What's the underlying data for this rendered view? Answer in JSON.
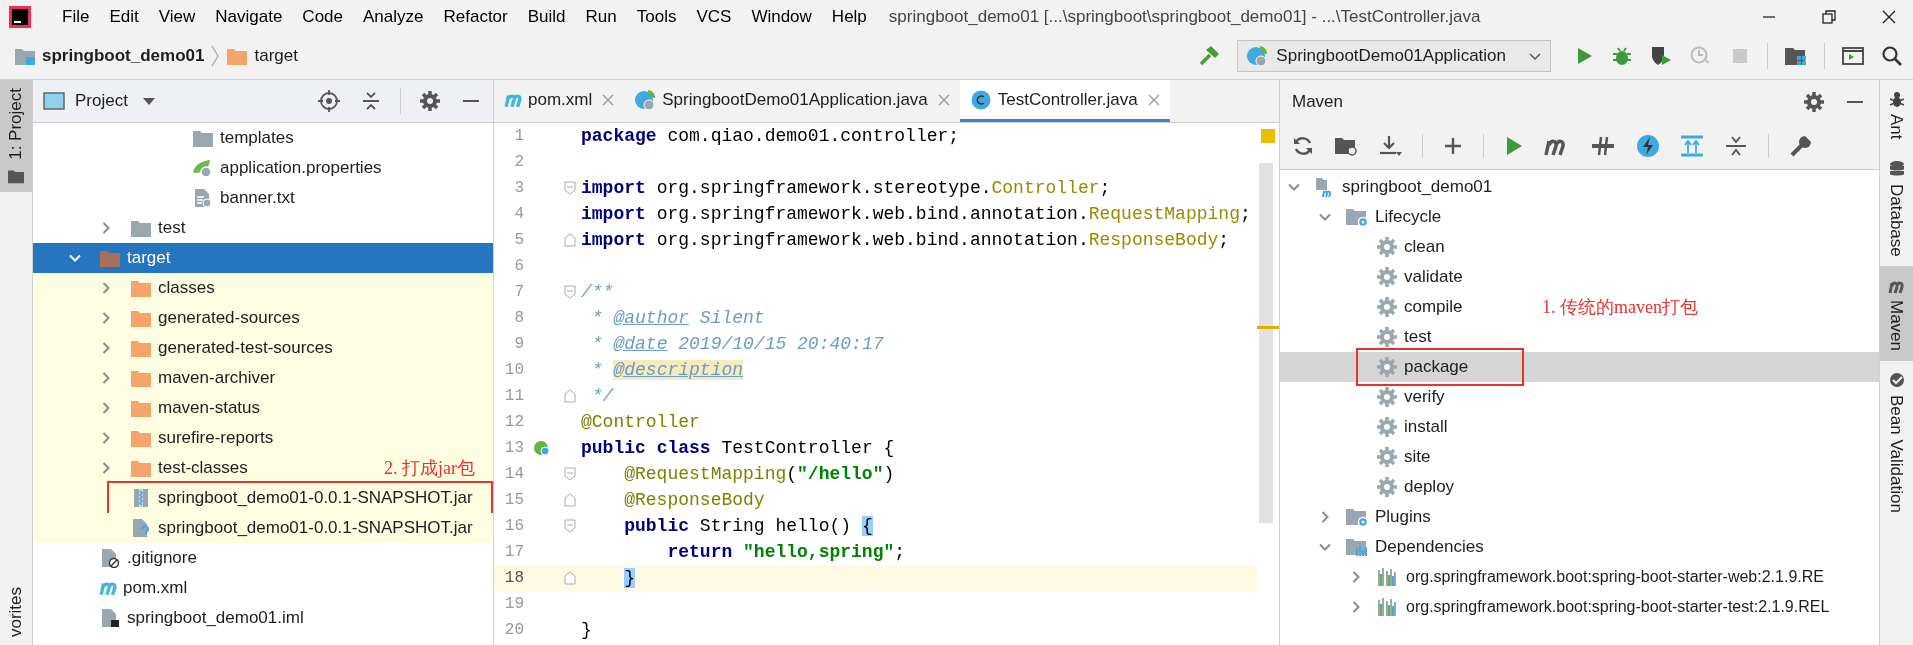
{
  "menu_bar": {
    "items": [
      "File",
      "Edit",
      "View",
      "Navigate",
      "Code",
      "Analyze",
      "Refactor",
      "Build",
      "Run",
      "Tools",
      "VCS",
      "Window",
      "Help"
    ],
    "title": "springboot_demo01 [...\\springboot\\springboot_demo01] - ...\\TestController.java"
  },
  "navigation_bar": {
    "breadcrumbs": [
      {
        "label": "springboot_demo01",
        "kind": "module"
      },
      {
        "label": "target",
        "kind": "output-folder"
      }
    ],
    "run_configuration": "SpringbootDemo01Application"
  },
  "left_strip": [
    {
      "label": "1: Project",
      "selected": true
    },
    {
      "label": "vorites",
      "selected": false
    }
  ],
  "project_panel": {
    "title": "Project",
    "tree": [
      {
        "children": [
          {
            "children": [
              {
                "children": [
                  {
                    "kind": "folder",
                    "label": "templates",
                    "selected": false,
                    "boxed": false
                  },
                  {
                    "kind": "properties-file",
                    "label": "application.properties",
                    "selected": false,
                    "boxed": false
                  },
                  {
                    "kind": "text-file",
                    "label": "banner.txt",
                    "selected": false,
                    "boxed": false
                  }
                ]
              }
            ]
          },
          {
            "kind": "folder",
            "label": "test",
            "expanded": false,
            "selected": false,
            "boxed": false
          }
        ]
      },
      {
        "kind": "excluded-folder",
        "label": "target",
        "expanded": true,
        "selected": true,
        "boxed": false,
        "children": [
          {
            "kind": "output-folder",
            "label": "classes",
            "expanded": false,
            "selected": false,
            "boxed": false
          },
          {
            "kind": "output-folder",
            "label": "generated-sources",
            "expanded": false,
            "selected": false,
            "boxed": false
          },
          {
            "kind": "output-folder",
            "label": "generated-test-sources",
            "expanded": false,
            "selected": false,
            "boxed": false
          },
          {
            "kind": "output-folder",
            "label": "maven-archiver",
            "expanded": false,
            "selected": false,
            "boxed": false
          },
          {
            "kind": "output-folder",
            "label": "maven-status",
            "expanded": false,
            "selected": false,
            "boxed": false
          },
          {
            "kind": "output-folder",
            "label": "surefire-reports",
            "expanded": false,
            "selected": false,
            "boxed": false
          },
          {
            "kind": "output-folder",
            "label": "test-classes",
            "expanded": false,
            "selected": false,
            "boxed": false,
            "note": "2. 打成jar包"
          },
          {
            "kind": "jar",
            "label": "springboot_demo01-0.0.1-SNAPSHOT.jar",
            "selected": false,
            "boxed": true
          },
          {
            "kind": "unknown-file",
            "label": "springboot_demo01-0.0.1-SNAPSHOT.jar",
            "selected": false,
            "boxed": false
          }
        ]
      },
      {
        "kind": "ignored-file",
        "label": ".gitignore",
        "selected": false,
        "boxed": false
      },
      {
        "kind": "maven-file",
        "label": "pom.xml",
        "selected": false,
        "boxed": false
      },
      {
        "kind": "module-file",
        "label": "springboot_demo01.iml",
        "selected": false,
        "boxed": false
      }
    ]
  },
  "editor": {
    "tabs": [
      {
        "label": "pom.xml",
        "kind": "maven-file",
        "selected": false
      },
      {
        "label": "SpringbootDemo01Application.java",
        "kind": "spring-class",
        "selected": false
      },
      {
        "label": "TestController.java",
        "kind": "class",
        "selected": true
      }
    ],
    "lines": [
      {
        "number": "1",
        "kind": "plain",
        "current": false,
        "segments": [
          {
            "kind": "keyword",
            "text": "package"
          },
          {
            "kind": "plain",
            "text": " com.qiao.demo01.controller;"
          }
        ]
      },
      {
        "number": "2",
        "kind": "plain",
        "current": false
      },
      {
        "number": "3",
        "kind": "fold-start",
        "current": false,
        "segments": [
          {
            "kind": "keyword",
            "text": "import"
          },
          {
            "kind": "plain",
            "text": " org.springframework.stereotype."
          },
          {
            "kind": "class-ref",
            "text": "Controller"
          },
          {
            "kind": "plain",
            "text": ";"
          }
        ]
      },
      {
        "number": "4",
        "kind": "plain",
        "current": false,
        "segments": [
          {
            "kind": "keyword",
            "text": "import"
          },
          {
            "kind": "plain",
            "text": " org.springframework.web.bind.annotation."
          },
          {
            "kind": "class-ref",
            "text": "RequestMapping"
          },
          {
            "kind": "plain",
            "text": ";"
          }
        ]
      },
      {
        "number": "5",
        "kind": "fold-end",
        "current": false,
        "segments": [
          {
            "kind": "keyword",
            "text": "import"
          },
          {
            "kind": "plain",
            "text": " org.springframework.web.bind.annotation."
          },
          {
            "kind": "class-ref",
            "text": "ResponseBody"
          },
          {
            "kind": "plain",
            "text": ";"
          }
        ]
      },
      {
        "number": "6",
        "kind": "plain",
        "current": false
      },
      {
        "number": "7",
        "kind": "fold-start",
        "current": false,
        "segments": [
          {
            "kind": "doc",
            "text": "/**"
          }
        ]
      },
      {
        "number": "8",
        "kind": "plain",
        "current": false,
        "segments": [
          {
            "kind": "doc",
            "text": " * "
          },
          {
            "kind": "doc-tag",
            "text": "@author"
          },
          {
            "kind": "doc",
            "text": " Silent"
          }
        ]
      },
      {
        "number": "9",
        "kind": "plain",
        "current": false,
        "segments": [
          {
            "kind": "doc",
            "text": " * "
          },
          {
            "kind": "doc-tag",
            "text": "@date"
          },
          {
            "kind": "doc",
            "text": " 2019/10/15 20:40:17"
          }
        ]
      },
      {
        "number": "10",
        "kind": "plain",
        "current": false,
        "segments": [
          {
            "kind": "doc",
            "text": " * "
          },
          {
            "kind": "doc-tag-marked",
            "text": "@description"
          }
        ]
      },
      {
        "number": "11",
        "kind": "fold-end",
        "current": false,
        "segments": [
          {
            "kind": "doc",
            "text": " */"
          }
        ]
      },
      {
        "number": "12",
        "kind": "plain",
        "current": false,
        "segments": [
          {
            "kind": "annotation",
            "text": "@Controller"
          }
        ]
      },
      {
        "number": "13",
        "kind": "bean-marker",
        "current": false,
        "segments": [
          {
            "kind": "keyword",
            "text": "public"
          },
          {
            "kind": "keyword",
            "text": " class"
          },
          {
            "kind": "plain",
            "text": " TestController {"
          }
        ]
      },
      {
        "number": "14",
        "kind": "fold-start",
        "current": false,
        "segments": [
          {
            "kind": "annotation",
            "text": "    @RequestMapping"
          },
          {
            "kind": "plain",
            "text": "("
          },
          {
            "kind": "string",
            "text": "\"/hello\""
          },
          {
            "kind": "plain",
            "text": ")"
          }
        ]
      },
      {
        "number": "15",
        "kind": "fold-end",
        "current": false,
        "segments": [
          {
            "kind": "annotation",
            "text": "    @ResponseBody"
          }
        ]
      },
      {
        "number": "16",
        "kind": "fold-start",
        "current": false,
        "segments": [
          {
            "kind": "keyword",
            "text": "    public"
          },
          {
            "kind": "plain",
            "text": " String hello() "
          },
          {
            "kind": "brace-match",
            "text": "{"
          }
        ]
      },
      {
        "number": "17",
        "kind": "plain",
        "current": false,
        "segments": [
          {
            "kind": "keyword",
            "text": "        return"
          },
          {
            "kind": "string",
            "text": " \"hello,spring\""
          },
          {
            "kind": "plain",
            "text": ";"
          }
        ]
      },
      {
        "number": "18",
        "kind": "fold-end",
        "current": true,
        "segments": [
          {
            "kind": "brace-match",
            "text": "    }"
          }
        ]
      },
      {
        "number": "19",
        "kind": "plain",
        "current": false
      },
      {
        "number": "20",
        "kind": "plain",
        "current": false,
        "segments": [
          {
            "kind": "plain",
            "text": "}"
          }
        ]
      }
    ]
  },
  "maven_panel": {
    "title": "Maven",
    "tree": [
      {
        "kind": "maven-project",
        "label": "springboot_demo01",
        "expanded": true,
        "selected": false,
        "boxed": false,
        "children": [
          {
            "kind": "lifecycle",
            "label": "Lifecycle",
            "expanded": true,
            "selected": false,
            "boxed": false,
            "children": [
              {
                "kind": "phase",
                "label": "clean",
                "selected": false,
                "boxed": false
              },
              {
                "kind": "phase",
                "label": "validate",
                "selected": false,
                "boxed": false
              },
              {
                "kind": "phase",
                "label": "compile",
                "selected": false,
                "boxed": false,
                "note": "1. 传统的maven打包"
              },
              {
                "kind": "phase",
                "label": "test",
                "selected": false,
                "boxed": false
              },
              {
                "kind": "phase",
                "label": "package",
                "selected": true,
                "boxed": true
              },
              {
                "kind": "phase",
                "label": "verify",
                "selected": false,
                "boxed": false
              },
              {
                "kind": "phase",
                "label": "install",
                "selected": false,
                "boxed": false
              },
              {
                "kind": "phase",
                "label": "site",
                "selected": false,
                "boxed": false
              },
              {
                "kind": "phase",
                "label": "deploy",
                "selected": false,
                "boxed": false
              }
            ]
          },
          {
            "kind": "plugins",
            "label": "Plugins",
            "expanded": false,
            "selected": false,
            "boxed": false
          },
          {
            "kind": "dependencies",
            "label": "Dependencies",
            "expanded": true,
            "selected": false,
            "boxed": false,
            "children": [
              {
                "kind": "dependency",
                "label": "org.springframework.boot:spring-boot-starter-web:2.1.9.RE",
                "expanded": false,
                "selected": false,
                "boxed": false
              },
              {
                "kind": "dependency",
                "label": "org.springframework.boot:spring-boot-starter-test:2.1.9.REL",
                "expanded": false,
                "selected": false,
                "boxed": false
              }
            ]
          }
        ]
      }
    ]
  },
  "right_strip": [
    {
      "label": "Ant",
      "kind": "ant",
      "selected": false
    },
    {
      "label": "Database",
      "kind": "database",
      "selected": false
    },
    {
      "label": "Maven",
      "kind": "maven",
      "selected": true
    },
    {
      "label": "Bean Validation",
      "kind": "bean",
      "selected": false
    }
  ]
}
